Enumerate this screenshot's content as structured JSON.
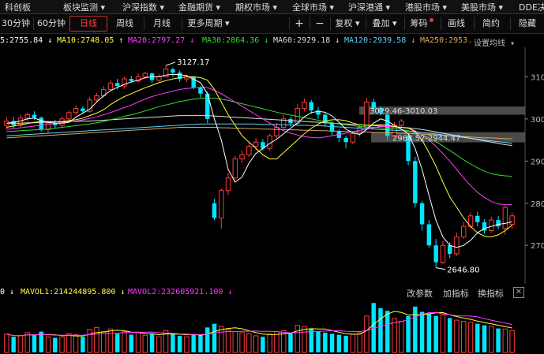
{
  "top_menu": [
    "科创板",
    "板块监测 ▾",
    "沪深指数 ▾",
    "金融期货 ▾",
    "期权市场 ▾",
    "全球市场 ▾",
    "沪深港通 ▾",
    "港股市场 ▾",
    "美股市场 ▾",
    "DDE决"
  ],
  "toolbar": {
    "periods": [
      "30分钟",
      "60分钟",
      "日线",
      "周线",
      "月线",
      "更多周期 ▾"
    ],
    "active_period": "日线",
    "plus": "+",
    "minus": "−",
    "fuquan": "复权 ▾",
    "diejia": "叠加 ▾",
    "chouma": "筹码",
    "huaxian": "画线",
    "jianyue": "简约",
    "yincang": "隐藏"
  },
  "ma_legend": {
    "ma5": "5:2755.84 ↓",
    "ma10": "MA10:2748.05 ↑",
    "ma20": "MA20:2797.27 ↓",
    "ma30": "MA30:2864.36 ↓",
    "ma60": "MA60:2929.18 ↓",
    "ma120": "MA120:2939.58 ↓",
    "ma250": "MA250:2953.",
    "settings": "设置均线 ▾"
  },
  "colors": {
    "up": "#ff3b3b",
    "down": "#00e5ff",
    "ma5": "#ffffff",
    "ma10": "#ffff3c",
    "ma20": "#ff3cff",
    "ma30": "#33dd33",
    "ma60": "#dddddd",
    "ma120": "#5ad2ff",
    "ma250": "#dda65a",
    "highlight_band": "#4a4a4a"
  },
  "price_axis_labels": [
    "310",
    "300",
    "290",
    "280",
    "270"
  ],
  "price_annotations": {
    "high": "3127.17",
    "low": "2646.80",
    "band1": "3029.46-3010.03",
    "band2": "2968.52-2944.47"
  },
  "vol_legend": {
    "vol": "0 ↓",
    "mavol1": "MAVOL1:214244895.800 ↓",
    "mavol2": "MAVOL2:232605921.100 ↓"
  },
  "vol_buttons": [
    "改参数",
    "加指标",
    "换指标"
  ],
  "close_glyph": "✕",
  "chart_data": {
    "type": "candlestick",
    "candles": [
      {
        "o": 2985,
        "c": 2995,
        "h": 3005,
        "l": 2975
      },
      {
        "o": 2995,
        "c": 2985,
        "h": 3005,
        "l": 2978
      },
      {
        "o": 2985,
        "c": 3002,
        "h": 3010,
        "l": 2980
      },
      {
        "o": 3002,
        "c": 3010,
        "h": 3015,
        "l": 2995
      },
      {
        "o": 3010,
        "c": 3003,
        "h": 3018,
        "l": 2998
      },
      {
        "o": 3003,
        "c": 2975,
        "h": 3006,
        "l": 2970
      },
      {
        "o": 2975,
        "c": 2990,
        "h": 2995,
        "l": 2965
      },
      {
        "o": 2990,
        "c": 2985,
        "h": 2998,
        "l": 2978
      },
      {
        "o": 2985,
        "c": 3000,
        "h": 3006,
        "l": 2980
      },
      {
        "o": 3000,
        "c": 3015,
        "h": 3020,
        "l": 2995
      },
      {
        "o": 3015,
        "c": 3025,
        "h": 3032,
        "l": 3010
      },
      {
        "o": 3025,
        "c": 3018,
        "h": 3030,
        "l": 3012
      },
      {
        "o": 3018,
        "c": 3045,
        "h": 3052,
        "l": 3015
      },
      {
        "o": 3045,
        "c": 3055,
        "h": 3062,
        "l": 3040
      },
      {
        "o": 3055,
        "c": 3070,
        "h": 3078,
        "l": 3050
      },
      {
        "o": 3070,
        "c": 3085,
        "h": 3092,
        "l": 3065
      },
      {
        "o": 3085,
        "c": 3078,
        "h": 3095,
        "l": 3070
      },
      {
        "o": 3078,
        "c": 3095,
        "h": 3100,
        "l": 3072
      },
      {
        "o": 3095,
        "c": 3090,
        "h": 3102,
        "l": 3085
      },
      {
        "o": 3090,
        "c": 3100,
        "h": 3108,
        "l": 3085
      },
      {
        "o": 3100,
        "c": 3108,
        "h": 3112,
        "l": 3095
      },
      {
        "o": 3108,
        "c": 3092,
        "h": 3110,
        "l": 3085
      },
      {
        "o": 3092,
        "c": 3100,
        "h": 3106,
        "l": 3088
      },
      {
        "o": 3100,
        "c": 3118,
        "h": 3127,
        "l": 3098
      },
      {
        "o": 3118,
        "c": 3110,
        "h": 3122,
        "l": 3100
      },
      {
        "o": 3110,
        "c": 3095,
        "h": 3115,
        "l": 3088
      },
      {
        "o": 3095,
        "c": 3100,
        "h": 3105,
        "l": 3088
      },
      {
        "o": 3100,
        "c": 3075,
        "h": 3102,
        "l": 3070
      },
      {
        "o": 3075,
        "c": 3060,
        "h": 3078,
        "l": 3050
      },
      {
        "o": 3060,
        "c": 3000,
        "h": 3065,
        "l": 2990
      },
      {
        "o": 2800,
        "c": 2765,
        "h": 2810,
        "l": 2760
      },
      {
        "o": 2765,
        "c": 2830,
        "h": 2835,
        "l": 2740
      },
      {
        "o": 2830,
        "c": 2860,
        "h": 2872,
        "l": 2820
      },
      {
        "o": 2860,
        "c": 2905,
        "h": 2912,
        "l": 2855
      },
      {
        "o": 2905,
        "c": 2915,
        "h": 2925,
        "l": 2895
      },
      {
        "o": 2915,
        "c": 2935,
        "h": 2945,
        "l": 2910
      },
      {
        "o": 2935,
        "c": 2945,
        "h": 2955,
        "l": 2925
      },
      {
        "o": 2945,
        "c": 2930,
        "h": 2952,
        "l": 2925
      },
      {
        "o": 2930,
        "c": 2960,
        "h": 2965,
        "l": 2925
      },
      {
        "o": 2960,
        "c": 2980,
        "h": 2990,
        "l": 2955
      },
      {
        "o": 2980,
        "c": 3000,
        "h": 3010,
        "l": 2975
      },
      {
        "o": 3000,
        "c": 2990,
        "h": 3005,
        "l": 2982
      },
      {
        "o": 2990,
        "c": 3025,
        "h": 3035,
        "l": 2985
      },
      {
        "o": 3025,
        "c": 3040,
        "h": 3048,
        "l": 3018
      },
      {
        "o": 3040,
        "c": 3020,
        "h": 3045,
        "l": 3012
      },
      {
        "o": 3020,
        "c": 3010,
        "h": 3028,
        "l": 3000
      },
      {
        "o": 3010,
        "c": 2990,
        "h": 3015,
        "l": 2982
      },
      {
        "o": 2990,
        "c": 2970,
        "h": 2995,
        "l": 2960
      },
      {
        "o": 2970,
        "c": 2955,
        "h": 2975,
        "l": 2945
      },
      {
        "o": 2955,
        "c": 2945,
        "h": 2960,
        "l": 2930
      },
      {
        "o": 2945,
        "c": 2965,
        "h": 2972,
        "l": 2940
      },
      {
        "o": 2965,
        "c": 2980,
        "h": 2985,
        "l": 2958
      },
      {
        "o": 2980,
        "c": 3040,
        "h": 3050,
        "l": 2975
      },
      {
        "o": 3040,
        "c": 3025,
        "h": 3048,
        "l": 3015
      },
      {
        "o": 3025,
        "c": 3015,
        "h": 3030,
        "l": 3008
      },
      {
        "o": 3010,
        "c": 2960,
        "h": 3012,
        "l": 2950
      },
      {
        "o": 2960,
        "c": 2985,
        "h": 2992,
        "l": 2955
      },
      {
        "o": 2985,
        "c": 2995,
        "h": 3000,
        "l": 2978
      },
      {
        "o": 2960,
        "c": 2900,
        "h": 2965,
        "l": 2890
      },
      {
        "o": 2900,
        "c": 2800,
        "h": 2910,
        "l": 2790
      },
      {
        "o": 2800,
        "c": 2750,
        "h": 2805,
        "l": 2735
      },
      {
        "o": 2750,
        "c": 2700,
        "h": 2760,
        "l": 2695
      },
      {
        "o": 2700,
        "c": 2660,
        "h": 2715,
        "l": 2646.8
      },
      {
        "o": 2660,
        "c": 2700,
        "h": 2710,
        "l": 2655
      },
      {
        "o": 2700,
        "c": 2680,
        "h": 2708,
        "l": 2670
      },
      {
        "o": 2680,
        "c": 2720,
        "h": 2730,
        "l": 2675
      },
      {
        "o": 2720,
        "c": 2745,
        "h": 2755,
        "l": 2715
      },
      {
        "o": 2745,
        "c": 2770,
        "h": 2778,
        "l": 2740
      },
      {
        "o": 2770,
        "c": 2755,
        "h": 2780,
        "l": 2745
      },
      {
        "o": 2755,
        "c": 2735,
        "h": 2762,
        "l": 2728
      },
      {
        "o": 2735,
        "c": 2760,
        "h": 2768,
        "l": 2730
      },
      {
        "o": 2760,
        "c": 2745,
        "h": 2770,
        "l": 2738
      },
      {
        "o": 2740,
        "c": 2790,
        "h": 2795,
        "l": 2725
      },
      {
        "o": 2750,
        "c": 2770,
        "h": 2778,
        "l": 2740
      }
    ],
    "ma5": [
      2990,
      2992,
      2995,
      3000,
      3002,
      2996,
      2992,
      2990,
      2990,
      2992,
      3004,
      3014,
      3023,
      3040,
      3055,
      3067,
      3075,
      3082,
      3088,
      3092,
      3098,
      3100,
      3100,
      3104,
      3106,
      3105,
      3103,
      3094,
      3086,
      3060,
      3000,
      2950,
      2880,
      2850,
      2862,
      2895,
      2918,
      2930,
      2942,
      2952,
      2965,
      2978,
      2990,
      3005,
      3015,
      3018,
      3016,
      3007,
      2992,
      2976,
      2967,
      2963,
      2975,
      2990,
      3000,
      2995,
      2985,
      2976,
      2965,
      2930,
      2880,
      2818,
      2760,
      2720,
      2700,
      2695,
      2700,
      2712,
      2730,
      2740,
      2745,
      2750,
      2752,
      2756
    ],
    "ma10": [
      2980,
      2983,
      2986,
      2989,
      2992,
      2994,
      2994,
      2993,
      2994,
      2996,
      2998,
      3002,
      3008,
      3014,
      3022,
      3034,
      3044,
      3053,
      3060,
      3067,
      3074,
      3080,
      3086,
      3091,
      3095,
      3098,
      3100,
      3100,
      3098,
      3092,
      3070,
      3040,
      3010,
      2985,
      2960,
      2945,
      2930,
      2915,
      2905,
      2905,
      2920,
      2935,
      2950,
      2965,
      2978,
      2988,
      2995,
      2998,
      2998,
      2996,
      2990,
      2986,
      2985,
      2985,
      2986,
      2985,
      2982,
      2980,
      2978,
      2970,
      2950,
      2920,
      2888,
      2850,
      2815,
      2790,
      2765,
      2745,
      2730,
      2722,
      2720,
      2725,
      2735,
      2748
    ],
    "ma20": [
      2975,
      2977,
      2979,
      2981,
      2983,
      2985,
      2987,
      2989,
      2991,
      2993,
      2995,
      2998,
      3001,
      3005,
      3010,
      3015,
      3021,
      3027,
      3033,
      3040,
      3047,
      3053,
      3058,
      3062,
      3066,
      3070,
      3072,
      3074,
      3075,
      3074,
      3068,
      3060,
      3050,
      3040,
      3030,
      3020,
      3010,
      3000,
      2990,
      2980,
      2972,
      2966,
      2962,
      2958,
      2956,
      2955,
      2957,
      2960,
      2963,
      2966,
      2970,
      2973,
      2976,
      2979,
      2982,
      2982,
      2982,
      2980,
      2978,
      2972,
      2962,
      2950,
      2935,
      2918,
      2900,
      2880,
      2860,
      2842,
      2826,
      2814,
      2804,
      2798,
      2797,
      2797
    ],
    "ma30": [
      2970,
      2971,
      2972,
      2973,
      2974,
      2975,
      2976,
      2978,
      2980,
      2982,
      2984,
      2986,
      2988,
      2991,
      2994,
      2998,
      3002,
      3006,
      3010,
      3014,
      3019,
      3024,
      3029,
      3033,
      3037,
      3041,
      3044,
      3047,
      3049,
      3050,
      3049,
      3047,
      3044,
      3040,
      3036,
      3032,
      3028,
      3024,
      3020,
      3016,
      3012,
      3009,
      3006,
      3003,
      3000,
      2997,
      2994,
      2991,
      2988,
      2986,
      2984,
      2982,
      2981,
      2980,
      2979,
      2978,
      2977,
      2975,
      2972,
      2968,
      2962,
      2955,
      2946,
      2936,
      2925,
      2914,
      2903,
      2893,
      2884,
      2876,
      2870,
      2867,
      2865,
      2864
    ],
    "ma60": [
      2990,
      2990,
      2990,
      2991,
      2991,
      2992,
      2992,
      2993,
      2993,
      2994,
      2994,
      2995,
      2995,
      2996,
      2997,
      2998,
      2999,
      3000,
      3001,
      3002,
      3003,
      3004,
      3005,
      3006,
      3007,
      3008,
      3008,
      3008,
      3008,
      3008,
      3007,
      3006,
      3005,
      3004,
      3003,
      3002,
      3001,
      3000,
      2999,
      2998,
      2997,
      2996,
      2995,
      2994,
      2993,
      2992,
      2991,
      2990,
      2989,
      2988,
      2987,
      2986,
      2985,
      2984,
      2983,
      2982,
      2981,
      2980,
      2979,
      2977,
      2975,
      2972,
      2969,
      2966,
      2963,
      2960,
      2957,
      2954,
      2951,
      2948,
      2945,
      2942,
      2939,
      2937
    ],
    "ma120": [
      2960,
      2961,
      2962,
      2963,
      2964,
      2965,
      2966,
      2967,
      2968,
      2969,
      2970,
      2971,
      2972,
      2973,
      2974,
      2975,
      2976,
      2977,
      2978,
      2979,
      2980,
      2981,
      2982,
      2983,
      2984,
      2985,
      2986,
      2987,
      2988,
      2988,
      2988,
      2988,
      2988,
      2988,
      2988,
      2988,
      2988,
      2987,
      2987,
      2987,
      2986,
      2986,
      2985,
      2985,
      2984,
      2984,
      2983,
      2982,
      2981,
      2980,
      2979,
      2978,
      2977,
      2976,
      2975,
      2974,
      2973,
      2972,
      2971,
      2970,
      2968,
      2966,
      2964,
      2962,
      2960,
      2958,
      2956,
      2954,
      2952,
      2950,
      2948,
      2946,
      2944,
      2942
    ],
    "ma250": [
      2955,
      2956,
      2957,
      2958,
      2959,
      2960,
      2961,
      2962,
      2963,
      2964,
      2965,
      2966,
      2967,
      2968,
      2969,
      2970,
      2971,
      2972,
      2973,
      2974,
      2975,
      2976,
      2977,
      2978,
      2979,
      2980,
      2980,
      2980,
      2980,
      2980,
      2980,
      2979,
      2979,
      2978,
      2978,
      2977,
      2977,
      2976,
      2976,
      2975,
      2975,
      2974,
      2974,
      2973,
      2973,
      2972,
      2972,
      2971,
      2971,
      2970,
      2970,
      2969,
      2969,
      2968,
      2968,
      2967,
      2967,
      2966,
      2966,
      2965,
      2964,
      2963,
      2962,
      2961,
      2960,
      2959,
      2958,
      2957,
      2956,
      2955,
      2955,
      2954,
      2953,
      2953
    ],
    "volume": [
      0.35,
      0.3,
      0.32,
      0.38,
      0.33,
      0.4,
      0.3,
      0.28,
      0.3,
      0.36,
      0.34,
      0.3,
      0.44,
      0.48,
      0.4,
      0.45,
      0.36,
      0.4,
      0.34,
      0.38,
      0.33,
      0.35,
      0.3,
      0.42,
      0.36,
      0.32,
      0.3,
      0.34,
      0.33,
      0.48,
      0.55,
      0.5,
      0.44,
      0.4,
      0.38,
      0.36,
      0.32,
      0.3,
      0.35,
      0.4,
      0.42,
      0.38,
      0.52,
      0.5,
      0.46,
      0.4,
      0.38,
      0.36,
      0.34,
      0.32,
      0.35,
      0.38,
      0.7,
      0.95,
      0.85,
      0.8,
      0.65,
      0.6,
      0.7,
      0.88,
      0.78,
      0.75,
      0.7,
      0.72,
      0.66,
      0.62,
      0.6,
      0.58,
      0.55,
      0.52,
      0.5,
      0.46,
      0.45,
      0.42
    ],
    "ylim": [
      2620,
      3140
    ]
  }
}
